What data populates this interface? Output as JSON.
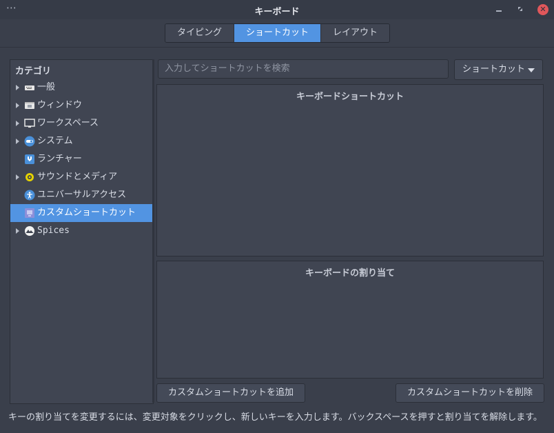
{
  "window": {
    "title": "キーボード",
    "menu_glyph": "⋯"
  },
  "tabs": [
    {
      "label": "タイピング",
      "active": false
    },
    {
      "label": "ショートカット",
      "active": true
    },
    {
      "label": "レイアウト",
      "active": false
    }
  ],
  "sidebar": {
    "header": "カテゴリ",
    "items": [
      {
        "label": "一般",
        "icon": "keyboard-icon",
        "expandable": true,
        "selected": false
      },
      {
        "label": "ウィンドウ",
        "icon": "window-icon",
        "expandable": true,
        "selected": false
      },
      {
        "label": "ワークスペース",
        "icon": "monitor-icon",
        "expandable": true,
        "selected": false
      },
      {
        "label": "システム",
        "icon": "system-toggle-icon",
        "expandable": true,
        "selected": false
      },
      {
        "label": "ランチャー",
        "icon": "launcher-icon",
        "expandable": false,
        "selected": false
      },
      {
        "label": "サウンドとメディア",
        "icon": "speaker-icon",
        "expandable": true,
        "selected": false
      },
      {
        "label": "ユニバーサルアクセス",
        "icon": "accessibility-icon",
        "expandable": false,
        "selected": false
      },
      {
        "label": "カスタムショートカット",
        "icon": "custom-shortcut-icon",
        "expandable": false,
        "selected": true
      },
      {
        "label": "Spices",
        "icon": "spices-icon",
        "expandable": true,
        "selected": false
      }
    ]
  },
  "search": {
    "placeholder": "入力してショートカットを検索"
  },
  "search_mode": {
    "label": "ショートカット"
  },
  "panels": {
    "shortcuts_title": "キーボードショートカット",
    "bindings_title": "キーボードの割り当て"
  },
  "buttons": {
    "add_custom": "カスタムショートカットを追加",
    "remove_custom": "カスタムショートカットを削除"
  },
  "footer": {
    "hint": "キーの割り当てを変更するには、変更対象をクリックし、新しいキーを入力します。バックスペースを押すと割り当てを解除します。"
  },
  "colors": {
    "accent": "#5294e2",
    "background": "#3a3f4b",
    "close": "#e0575b"
  }
}
